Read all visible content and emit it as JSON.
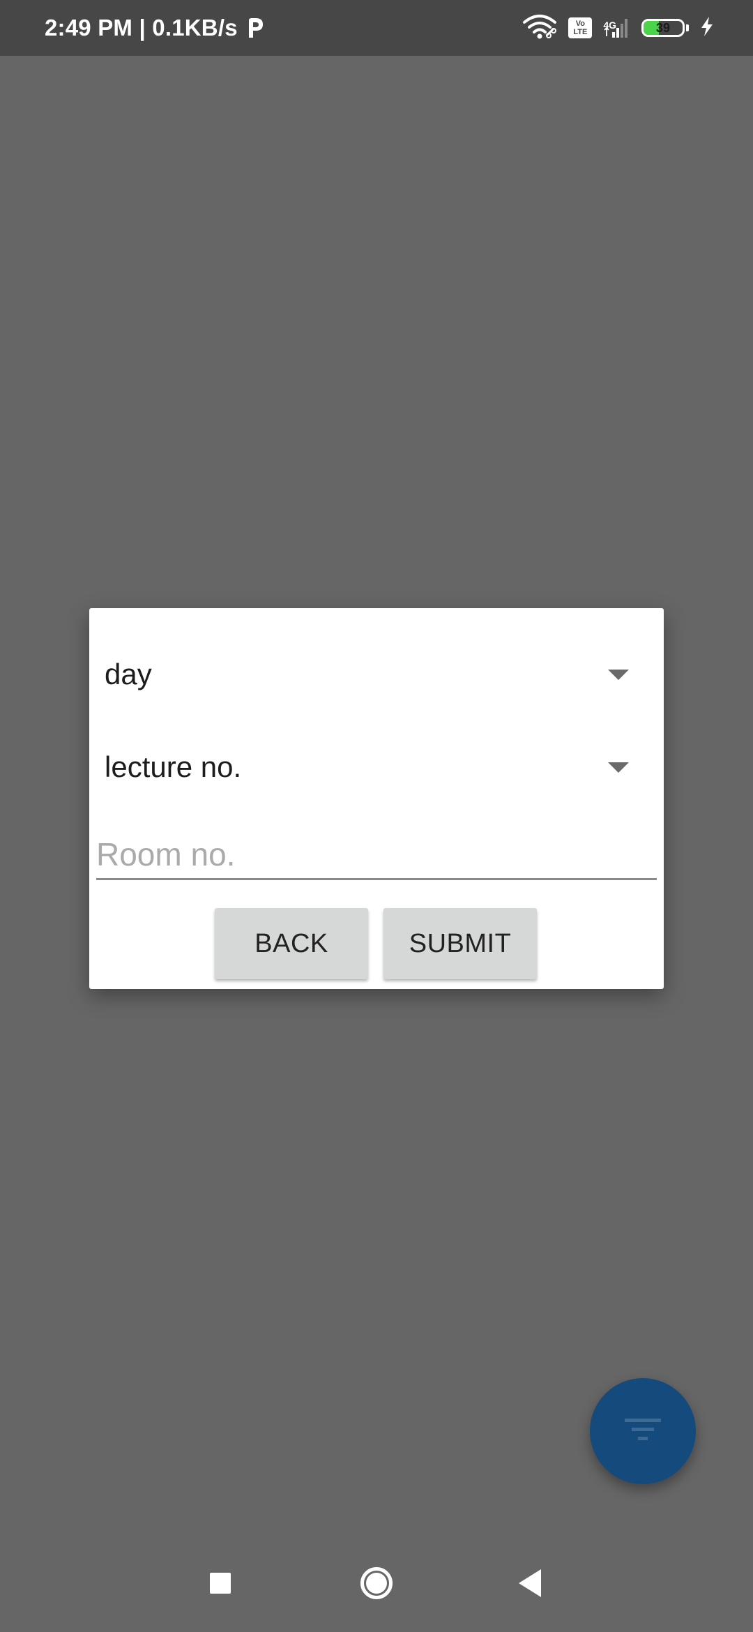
{
  "status_bar": {
    "time_speed": "2:49 PM | 0.1KB/s",
    "volte_top": "Vo",
    "volte_bottom": "LTE",
    "network_type": "4G",
    "battery_level": 39,
    "battery_text": "39",
    "icons": [
      "parking-p-icon",
      "wifi-icon",
      "volte-icon",
      "signal-icon",
      "battery-icon",
      "charging-bolt-icon"
    ]
  },
  "dialog": {
    "day_spinner": {
      "value": "day"
    },
    "lecture_spinner": {
      "value": "lecture no."
    },
    "room_input": {
      "value": "",
      "placeholder": "Room no."
    },
    "back_label": "BACK",
    "submit_label": "SUBMIT"
  },
  "fab": {
    "icon": "filter-icon"
  },
  "nav_bar": {
    "icons": [
      "recent-apps-icon",
      "home-icon",
      "back-icon"
    ]
  },
  "colors": {
    "status_bar_bg": "#474747",
    "screen_scrim": "#666666",
    "dialog_bg": "#ffffff",
    "button_bg": "#d6d7d7",
    "fab_bg": "#154a7c",
    "battery_fill": "#4cd34c"
  }
}
